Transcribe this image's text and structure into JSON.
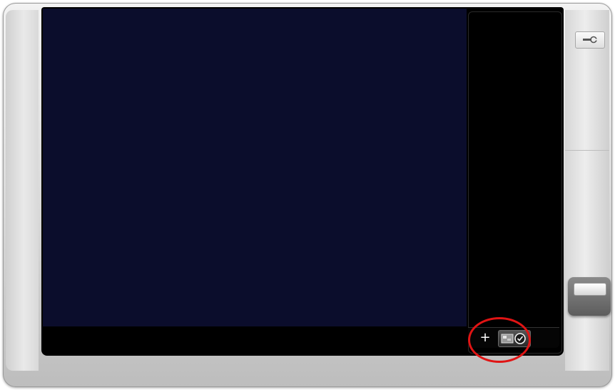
{
  "panel": {
    "add_label": "+"
  },
  "icons": {
    "add": "plus-icon",
    "status": "camera-clock-icon",
    "tool": "wrench-icon"
  },
  "colors": {
    "video_background": "#0b0d2c",
    "panel_background": "#000000",
    "highlight": "#e01414",
    "frame": "#d8d8d8"
  }
}
